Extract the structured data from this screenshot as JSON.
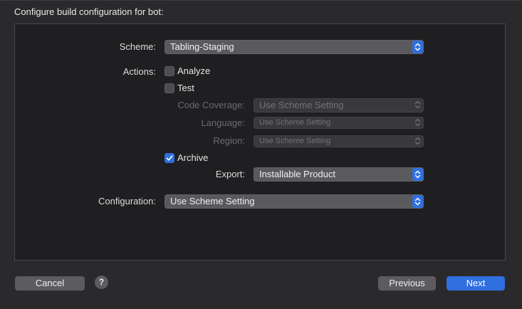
{
  "dialog": {
    "title": "Configure build configuration for bot:"
  },
  "form": {
    "scheme": {
      "label": "Scheme:",
      "value": "Tabling-Staging"
    },
    "actions_label": "Actions:",
    "analyze": {
      "label": "Analyze",
      "checked": false
    },
    "test": {
      "label": "Test",
      "checked": false
    },
    "code_coverage": {
      "label": "Code Coverage:",
      "value": "Use Scheme Setting"
    },
    "language": {
      "label": "Language:",
      "value": "Use Scheme Setting"
    },
    "region": {
      "label": "Region:",
      "value": "Use Scheme Setting"
    },
    "archive": {
      "label": "Archive",
      "checked": true
    },
    "export": {
      "label": "Export:",
      "value": "Installable Product"
    },
    "configuration": {
      "label": "Configuration:",
      "value": "Use Scheme Setting"
    }
  },
  "footer": {
    "cancel_label": "Cancel",
    "help_label": "?",
    "previous_label": "Previous",
    "next_label": "Next"
  },
  "colors": {
    "accent": "#2f6fe0",
    "background": "#2a2a2c",
    "panel": "#1f1f21"
  }
}
